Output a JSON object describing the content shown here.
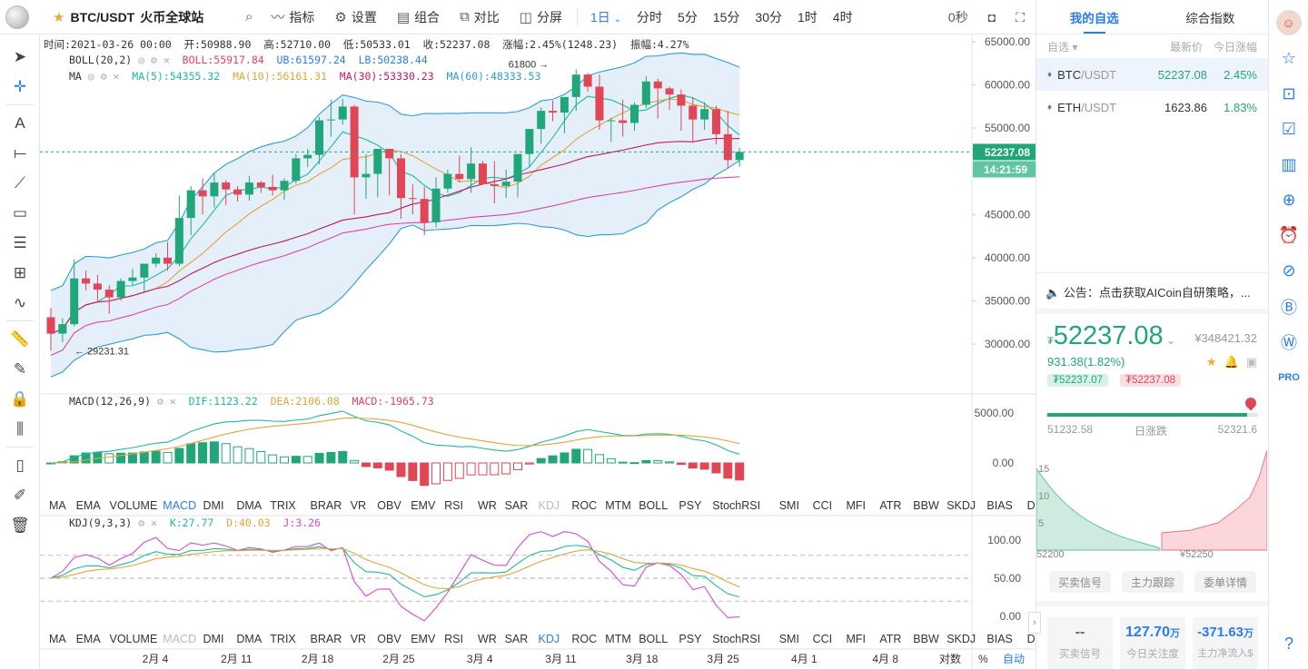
{
  "header": {
    "symbol": "BTC/USDT",
    "exchange": "火币全球站",
    "tools": [
      "指标",
      "设置",
      "组合",
      "对比",
      "分屏"
    ],
    "periods": [
      "1日",
      "分时",
      "5分",
      "15分",
      "30分",
      "1时",
      "4时"
    ],
    "active_period": "1日",
    "countdown": "0秒"
  },
  "ohlc": {
    "time": "时间:2021-03-26 00:00",
    "open": "开:50988.90",
    "high": "高:52710.00",
    "low": "低:50533.01",
    "close": "收:52237.08",
    "change": "涨幅:2.45%(1248.23)",
    "amplitude": "振幅:4.27%"
  },
  "indicators": {
    "boll_name": "BOLL(20,2)",
    "boll_val": "BOLL:55917.84",
    "ub": "UB:61597.24",
    "lb": "LB:50238.44",
    "ma_name": "MA",
    "ma5": "MA(5):54355.32",
    "ma10": "MA(10):56161.31",
    "ma30": "MA(30):53330.23",
    "ma60": "MA(60):48333.53",
    "macd_name": "MACD(12,26,9)",
    "dif": "DIF:1123.22",
    "dea": "DEA:2106.08",
    "macd": "MACD:-1965.73",
    "kdj_name": "KDJ(9,3,3)",
    "k": "K:27.77",
    "d": "D:40.03",
    "j": "J:3.26"
  },
  "price_axis": [
    "65000.00",
    "60000.00",
    "55000.00",
    "50000.00",
    "45000.00",
    "40000.00",
    "35000.00",
    "30000.00"
  ],
  "current_price_tag": "52237.08",
  "countdown_tag": "14:21:59",
  "high_marker": "61800",
  "low_marker": "29231.31",
  "macd_axis": [
    "5000.00",
    "0.00"
  ],
  "kdj_axis": [
    "100.00",
    "50.00",
    "0.00"
  ],
  "indicator_tabs": [
    "MA",
    "EMA",
    "VOLUME",
    "MACD",
    "DMI",
    "DMA",
    "TRIX",
    "BRAR",
    "VR",
    "OBV",
    "EMV",
    "RSI",
    "WR",
    "SAR",
    "KDJ",
    "ROC",
    "MTM",
    "BOLL",
    "PSY",
    "StochRSI",
    "SMI",
    "CCI",
    "MFI",
    "ATR",
    "BBW",
    "SKDJ",
    "BIAS",
    "DPO",
    "AO"
  ],
  "date_axis": [
    "2月 4",
    "2月 11",
    "2月 18",
    "2月 25",
    "3月 4",
    "3月 11",
    "3月 18",
    "3月 25",
    "4月 1",
    "4月 8"
  ],
  "bottom_controls": [
    "对数",
    "%",
    "自动"
  ],
  "chart_data": {
    "type": "candlestick",
    "candles": [
      [
        33100,
        34200,
        29231,
        31200
      ],
      [
        31200,
        33000,
        30200,
        32300
      ],
      [
        32300,
        39800,
        32000,
        37600
      ],
      [
        37600,
        38500,
        36200,
        37000
      ],
      [
        37000,
        38000,
        35000,
        36300
      ],
      [
        36300,
        36800,
        33500,
        35400
      ],
      [
        35400,
        37600,
        35000,
        37300
      ],
      [
        37300,
        38700,
        36800,
        37700
      ],
      [
        37700,
        38400,
        36100,
        39300
      ],
      [
        39300,
        40500,
        38900,
        40000
      ],
      [
        40000,
        41800,
        38500,
        39300
      ],
      [
        39300,
        47200,
        39000,
        44600
      ],
      [
        44600,
        48300,
        42600,
        47800
      ],
      [
        47800,
        49200,
        45000,
        47100
      ],
      [
        47100,
        49700,
        45800,
        48700
      ],
      [
        48700,
        49000,
        46100,
        47900
      ],
      [
        47900,
        48300,
        46500,
        47300
      ],
      [
        47300,
        49500,
        46600,
        48700
      ],
      [
        48700,
        48900,
        47500,
        48200
      ],
      [
        48200,
        49600,
        47200,
        47800
      ],
      [
        47800,
        49200,
        46700,
        48900
      ],
      [
        48900,
        52000,
        48600,
        51500
      ],
      [
        51500,
        52600,
        50500,
        51900
      ],
      [
        51900,
        56300,
        50800,
        55900
      ],
      [
        55900,
        58300,
        54000,
        56000
      ],
      [
        56000,
        58400,
        55400,
        57500
      ],
      [
        57500,
        57700,
        45000,
        49300
      ],
      [
        49300,
        52000,
        46800,
        49700
      ],
      [
        49700,
        52600,
        47000,
        52600
      ],
      [
        52600,
        52100,
        47200,
        51500
      ],
      [
        51500,
        52000,
        44500,
        46900
      ],
      [
        46900,
        48500,
        45000,
        46800
      ],
      [
        46800,
        48200,
        42600,
        44100
      ],
      [
        44100,
        49300,
        43500,
        48000
      ],
      [
        48000,
        50200,
        47500,
        49700
      ],
      [
        49700,
        51800,
        48700,
        49100
      ],
      [
        49100,
        52800,
        47500,
        50900
      ],
      [
        50900,
        51200,
        48900,
        48500
      ],
      [
        48500,
        51200,
        46300,
        48300
      ],
      [
        48300,
        50200,
        46900,
        48800
      ],
      [
        48800,
        51800,
        47000,
        52000
      ],
      [
        52000,
        54900,
        50500,
        54900
      ],
      [
        54900,
        57400,
        53200,
        57000
      ],
      [
        57000,
        58200,
        55800,
        56800
      ],
      [
        56800,
        58300,
        54400,
        58600
      ],
      [
        58600,
        61800,
        57000,
        61200
      ],
      [
        61200,
        61400,
        59200,
        59800
      ],
      [
        59800,
        61200,
        54800,
        55900
      ],
      [
        55900,
        56200,
        53400,
        55900
      ],
      [
        55900,
        58300,
        54000,
        55600
      ],
      [
        55600,
        58000,
        54700,
        57700
      ],
      [
        57700,
        61000,
        57300,
        60400
      ],
      [
        60400,
        60700,
        56100,
        59600
      ],
      [
        59600,
        59800,
        57100,
        58900
      ],
      [
        58900,
        59500,
        54700,
        57600
      ],
      [
        57600,
        58600,
        53300,
        56000
      ],
      [
        56000,
        58000,
        54800,
        57200
      ],
      [
        57200,
        57600,
        53100,
        54300
      ],
      [
        54300,
        57000,
        50400,
        51300
      ],
      [
        51300,
        52710,
        50533,
        52237
      ]
    ]
  },
  "watchlist": {
    "tabs": [
      "我的自选",
      "综合指数"
    ],
    "header": [
      "自选",
      "最新价",
      "今日涨幅"
    ],
    "items": [
      {
        "name": "BTC",
        "quote": "/USDT",
        "price": "52237.08",
        "change": "2.45%"
      },
      {
        "name": "ETH",
        "quote": "/USDT",
        "price": "1623.86",
        "change": "1.83%"
      }
    ]
  },
  "notice": "公告：点击获取AICoin自研策略，...",
  "quote": {
    "price": "52237.08",
    "currency": "₮",
    "cny": "¥348421.32",
    "change": "931.38(1.82%)",
    "bid": "₮52237.07",
    "ask": "₮52237.08",
    "range_low": "51232.58",
    "range_label": "日涨跌",
    "range_high": "52321.6"
  },
  "depth": {
    "ylabels": [
      "15",
      "10",
      "5"
    ],
    "bid_label": "52200",
    "ask_label": "¥52250"
  },
  "panel_buttons": [
    "买卖信号",
    "主力跟踪",
    "委单详情"
  ],
  "stats": [
    {
      "value": "--",
      "label": "买卖信号"
    },
    {
      "value": "127.70",
      "unit": "万",
      "label": "今日关注度"
    },
    {
      "value": "-371.63",
      "unit": "万",
      "label": "主力净流入$"
    }
  ],
  "colors": {
    "up": "#21a67a",
    "down": "#e04656",
    "accent": "#2b7de9"
  }
}
